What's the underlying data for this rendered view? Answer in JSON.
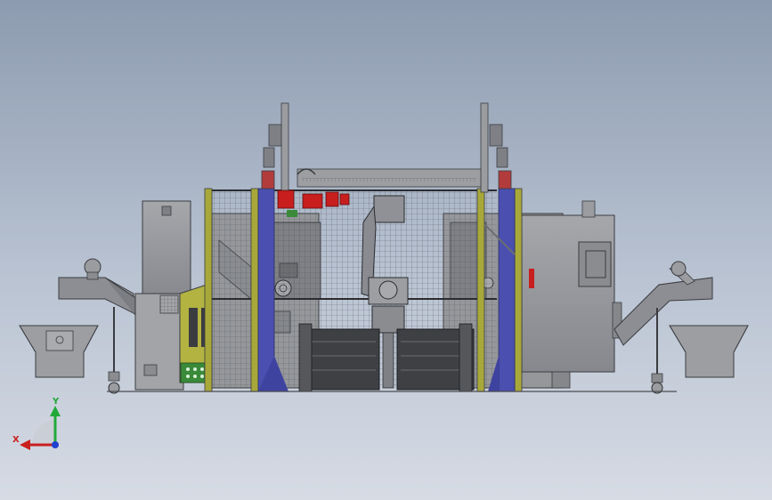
{
  "viewport": {
    "background_top": "#8d9bb0",
    "background_bottom": "#d6dbe4"
  },
  "triad": {
    "x_label": "X",
    "y_label": "Y",
    "x_color": "#c8201e",
    "y_color": "#22a83a",
    "z_color": "#1f3fd0"
  },
  "colors": {
    "frame_yellow": "#a8a83a",
    "guard_blue": "#4a4fb0",
    "actuator_red": "#c81e1e",
    "machine_grey": "#8f9196",
    "fence_mesh": "#5a5d60",
    "control_panel_green": "#3a8a3a"
  },
  "components": [
    "left-chip-conveyor",
    "left-chip-bin",
    "left-electrical-cabinet",
    "left-cnc-machine",
    "robot-cell-fence",
    "robot-arm",
    "part-pallet-station",
    "right-cnc-machine",
    "right-chip-conveyor",
    "right-chip-bin"
  ]
}
